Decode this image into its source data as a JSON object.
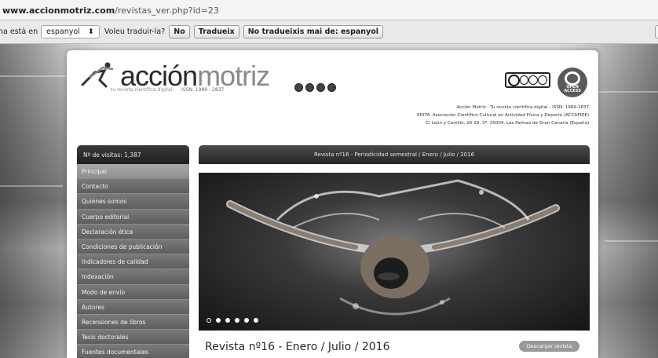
{
  "browser": {
    "url_host": "www.accionmotriz.com",
    "url_path": "/revistas_ver.php?id=23"
  },
  "translate_bar": {
    "prefix_text": "na està en",
    "language_value": "espanyol",
    "question": "Voleu traduir-la?",
    "no_button": "No",
    "translate_button": "Tradueix",
    "never_button": "No tradueixis mai de: espanyol"
  },
  "header": {
    "logo_word_dark": "acción",
    "logo_word_light": "motriz",
    "logo_tagline": "tu revista científica digital",
    "logo_issn": "ISSN: 1989 - 2837",
    "open_access_label": "OPEN ACCESS",
    "info_line1": "Acción Motriz - Tu revista científica digital - ISSN: 1989-2837.",
    "info_line2": "EDITA: Asociación Científico Cultural en Actividad Física y Deporte (ACCAFIDE).",
    "info_line3": "C/ León y Castillo, 26-28, 3º. 35004. Las Palmas de Gran Canaria (España)."
  },
  "sidebar": {
    "visits": "Nº de visitas: 1,387",
    "items": [
      {
        "label": "Principal"
      },
      {
        "label": "Contacto"
      },
      {
        "label": "Quienes somos"
      },
      {
        "label": "Cuerpo editorial"
      },
      {
        "label": "Declaración ética"
      },
      {
        "label": "Condiciones de publicación"
      },
      {
        "label": "Indicadores de calidad"
      },
      {
        "label": "Indexación"
      },
      {
        "label": "Modo de envío"
      },
      {
        "label": "Autores"
      },
      {
        "label": "Recensiones de libros"
      },
      {
        "label": "Tesis doctorales"
      },
      {
        "label": "Fuentes documentales"
      }
    ]
  },
  "main": {
    "banner": "Revista nº16 - Periodicidad semestral / Enero / Julio / 2016",
    "issue_title": "Revista nº16 - Enero / Julio / 2016",
    "download_button": "Descargar revista",
    "slider_active_index": 0,
    "slider_count": 6
  }
}
